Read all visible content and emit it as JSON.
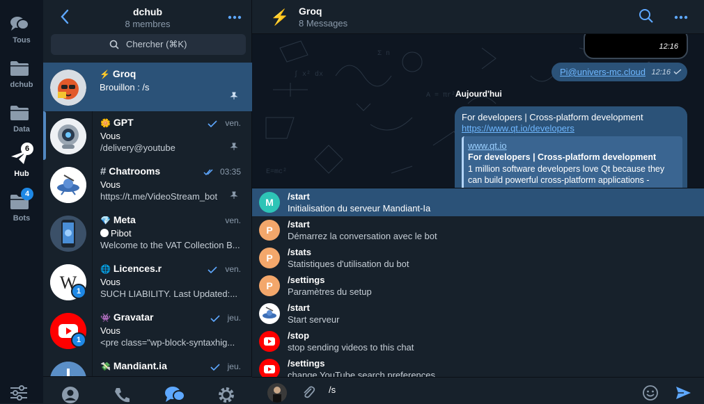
{
  "colors": {
    "accent": "#5288c1",
    "active_row": "#2b5278",
    "badge_blue": "#1e88e5",
    "send": "#5ea8ff"
  },
  "rail": {
    "folders": [
      {
        "label": "Tous",
        "icon": "chat-bubbles-icon"
      },
      {
        "label": "dchub",
        "icon": "folder-icon"
      },
      {
        "label": "Data",
        "icon": "folder-icon"
      },
      {
        "label": "Hub",
        "icon": "paper-plane-icon",
        "badge": "6"
      },
      {
        "label": "Bots",
        "icon": "folder-icon",
        "badge": "4"
      }
    ],
    "settings_icon": "sliders-icon"
  },
  "list": {
    "title": "dchub",
    "subtitle": "8 membres",
    "search_placeholder": "Chercher (⌘K)",
    "chats": [
      {
        "emoji": "⚡",
        "name": "Groq",
        "time": "",
        "line1": "Brouillon : /s",
        "line2": "",
        "pinned": true,
        "read": false
      },
      {
        "emoji": "🌼",
        "name": "GPT",
        "time": "ven.",
        "line1": "Vous",
        "line2": "/delivery@youtube",
        "pinned": true,
        "read": true
      },
      {
        "emoji": "#",
        "name": "Chatrooms",
        "time": "03:35",
        "line1": "Vous",
        "line2": "https://t.me/VideoStream_bot",
        "pinned": true,
        "read": true
      },
      {
        "emoji": "💎",
        "name": "Meta",
        "time": "ven.",
        "line1": "Pibot",
        "line2": "Welcome to the VAT Collection B...",
        "pinned": false,
        "read": false
      },
      {
        "emoji": "🌐",
        "name": "Licences.r",
        "time": "ven.",
        "line1": "Vous",
        "line2": "SUCH LIABILITY. Last Updated:...",
        "pinned": false,
        "read": true,
        "badge": "1"
      },
      {
        "emoji": "👾",
        "name": "Gravatar",
        "time": "jeu.",
        "line1": "Vous",
        "line2": "<pre class=\"wp-block-syntaxhig...",
        "pinned": false,
        "read": true,
        "badge": "1"
      },
      {
        "emoji": "💸",
        "name": "Mandiant.ia",
        "time": "jeu.",
        "line1": "",
        "line2": "",
        "pinned": false,
        "read": true
      }
    ],
    "footer_icons": [
      "person-icon",
      "phone-icon",
      "chats-icon",
      "settings-icon"
    ]
  },
  "chat": {
    "title": "Groq",
    "subtitle": "8 Messages",
    "header_emoji": "⚡",
    "prev_time": "12:16",
    "msg_link": "Pi@univers-mc.cloud",
    "msg_link_time": "12:16",
    "day": "Aujourd'hui",
    "card": {
      "text": "For developers | Cross-platform development",
      "url": "https://www.qt.io/developers",
      "preview_site": "www.qt.io",
      "preview_title": "For developers | Cross-platform development",
      "preview_desc": "1 million software developers love Qt because they can build powerful cross-platform applications -"
    },
    "commands": [
      {
        "cmd": "/start",
        "desc": "Initialisation du serveur Mandiant-Ia",
        "avatar": "M",
        "color": "#2ec4b6"
      },
      {
        "cmd": "/start",
        "desc": "Démarrez la conversation avec le bot",
        "avatar": "P",
        "color": "#f3a76b"
      },
      {
        "cmd": "/stats",
        "desc": "Statistiques d'utilisation du bot",
        "avatar": "P",
        "color": "#f3a76b"
      },
      {
        "cmd": "/settings",
        "desc": "Paramètres du setup",
        "avatar": "P",
        "color": "#f3a76b"
      },
      {
        "cmd": "/start",
        "desc": "Start serveur",
        "avatar": "",
        "color": "#ffffff"
      },
      {
        "cmd": "/stop",
        "desc": "stop sending videos to this chat",
        "avatar": "",
        "color": "#ff0000"
      },
      {
        "cmd": "/settings",
        "desc": "change YouTube search preferences",
        "avatar": "",
        "color": "#ff0000"
      }
    ],
    "input_text": "/s"
  }
}
